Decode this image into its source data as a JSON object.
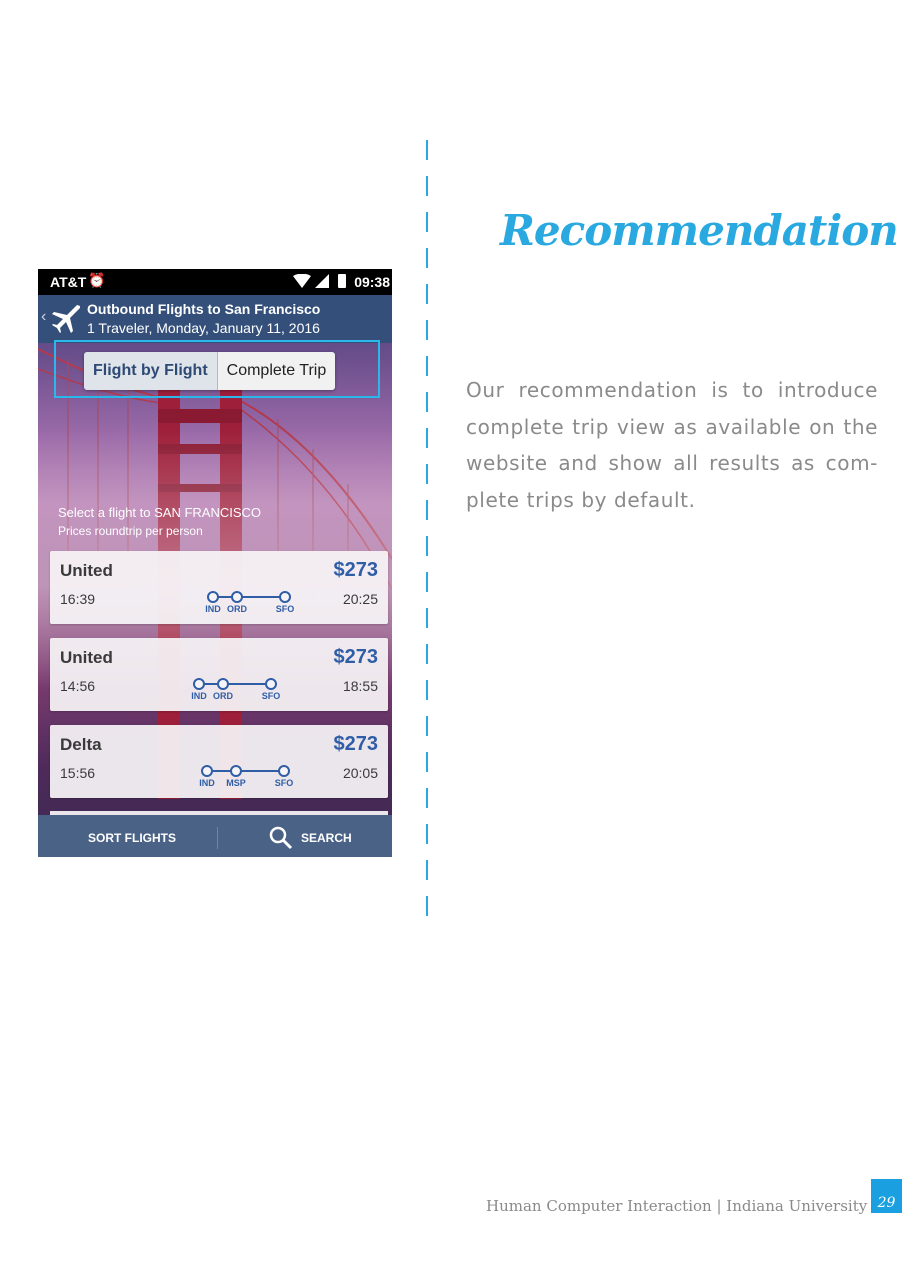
{
  "heading": "Recommendation",
  "body_text": "Our recommendation is to introduce complete trip view as available on the website and show all results as com-plete trips by default.",
  "footer": {
    "text": "Human Computer Interaction | Indiana University",
    "page_number": "29"
  },
  "phone": {
    "status_bar": {
      "carrier": "AT&T",
      "time": "09:38"
    },
    "app_bar": {
      "title": "Outbound Flights to San Francisco",
      "subtitle": "1 Traveler, Monday, January 11, 2016"
    },
    "toggle": {
      "flight_by_flight": "Flight by Flight",
      "complete_trip": "Complete Trip"
    },
    "select_prompt": "Select a flight to SAN FRANCISCO",
    "price_note": "Prices roundtrip per person",
    "flights": [
      {
        "airline": "United",
        "price": "$273",
        "depart": "16:39",
        "arrive": "20:25",
        "stops": [
          "IND",
          "ORD",
          "SFO"
        ]
      },
      {
        "airline": "United",
        "price": "$273",
        "depart": "14:56",
        "arrive": "18:55",
        "stops": [
          "IND",
          "ORD",
          "SFO"
        ]
      },
      {
        "airline": "Delta",
        "price": "$273",
        "depart": "15:56",
        "arrive": "20:05",
        "stops": [
          "IND",
          "MSP",
          "SFO"
        ]
      }
    ],
    "bottom_bar": {
      "sort_label": "SORT FLIGHTS",
      "search_label": "SEARCH"
    }
  },
  "colors": {
    "accent": "#29a9e0",
    "app_bar": "#34507a",
    "price": "#2f5da6"
  }
}
